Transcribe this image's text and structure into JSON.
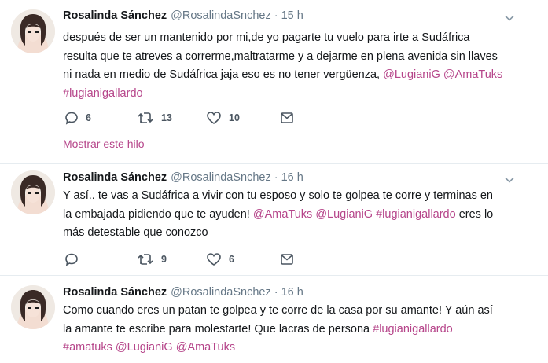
{
  "tweets": [
    {
      "name": "Rosalinda Sánchez",
      "handle": "@RosalindaSnchez",
      "separator": "·",
      "time": "15 h",
      "text_plain": "después de ser un mantenido por mi,de yo pagarte tu vuelo para irte a Sudáfrica resulta que te atreves a correrme,maltratarme y a dejarme en plena avenida sin llaves ni nada en medio de Sudáfrica jaja eso es no tener vergüenza,",
      "mention1": "@LugianiG",
      "mention2": "@AmaTuks",
      "hashtag1": "#lugianigallardo",
      "replies": "6",
      "retweets": "13",
      "likes": "10",
      "thread_link": "Mostrar este hilo"
    },
    {
      "name": "Rosalinda Sánchez",
      "handle": "@RosalindaSnchez",
      "separator": "·",
      "time": "16 h",
      "text_plain": "Y así.. te vas a Sudáfrica a vivir con tu esposo y solo te golpea te corre y terminas en la embajada pidiendo que te ayuden!",
      "mention1": "@AmaTuks",
      "mention2": "@LugianiG",
      "hashtag1": "#lugianigallardo",
      "text_tail": "eres lo más detestable que conozco",
      "replies": "",
      "retweets": "9",
      "likes": "6"
    },
    {
      "name": "Rosalinda Sánchez",
      "handle": "@RosalindaSnchez",
      "separator": "·",
      "time": "16 h",
      "text_plain": "Como cuando eres un patan te golpea y te corre de la casa por su amante! Y aún así la amante te escribe para molestarte! Que lacras de persona",
      "hashtag1": "#lugianigallardo",
      "hashtag2": "#amatuks",
      "mention1": "@LugianiG",
      "mention2": "@AmaTuks"
    }
  ],
  "colors": {
    "link": "#b6458a",
    "muted": "#657786",
    "divider": "#e6ecf0"
  },
  "icons": [
    "avatar",
    "chevron-down-icon",
    "reply-icon",
    "retweet-icon",
    "like-icon",
    "dm-icon"
  ]
}
